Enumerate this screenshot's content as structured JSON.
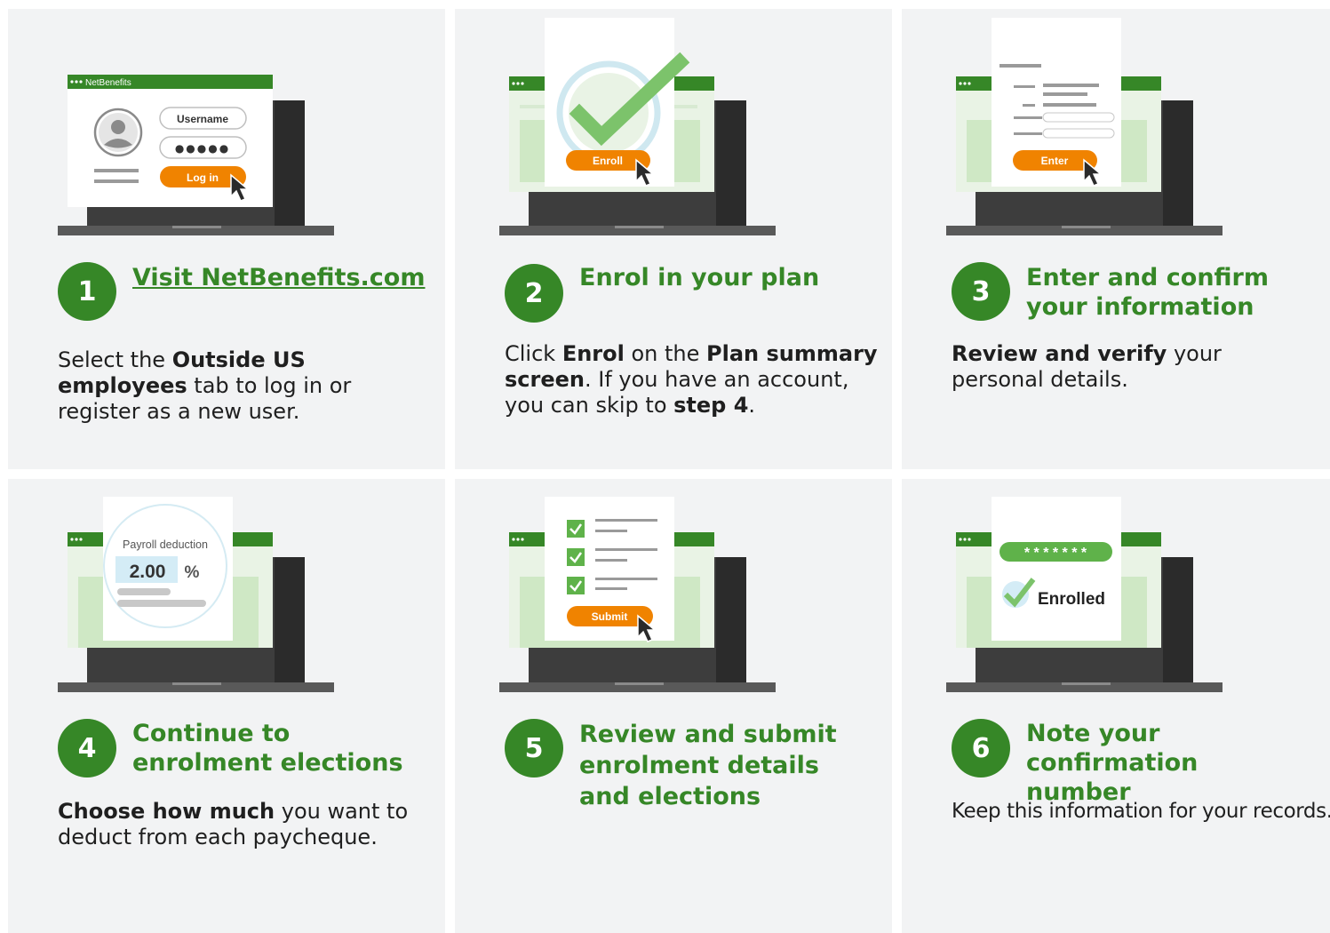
{
  "steps": [
    {
      "number": "1",
      "title": "Visit NetBenefits.com",
      "body": [
        {
          "text": "Select the ",
          "bold": false
        },
        {
          "text": "Outside US employees",
          "bold": true
        },
        {
          "text": " tab to log in or register as a new user.",
          "bold": false
        }
      ],
      "screen": {
        "brand": "NetBenefits",
        "username_label": "Username",
        "password_mask": "●●●●●",
        "button_label": "Log in"
      }
    },
    {
      "number": "2",
      "title": "Enrol in your plan",
      "body": [
        {
          "text": "Click ",
          "bold": false
        },
        {
          "text": "Enrol",
          "bold": true
        },
        {
          "text": " on the ",
          "bold": false
        },
        {
          "text": "Plan summary screen",
          "bold": true
        },
        {
          "text": ". If you have an account, you can skip to ",
          "bold": false
        },
        {
          "text": "step 4",
          "bold": true
        },
        {
          "text": ".",
          "bold": false
        }
      ],
      "screen": {
        "button_label": "Enroll"
      }
    },
    {
      "number": "3",
      "title": "Enter and confirm your information",
      "body": [
        {
          "text": "Review and verify",
          "bold": true
        },
        {
          "text": " your personal details.",
          "bold": false
        }
      ],
      "screen": {
        "button_label": "Enter"
      }
    },
    {
      "number": "4",
      "title": "Continue to enrolment elections",
      "body": [
        {
          "text": "Choose how much",
          "bold": true
        },
        {
          "text": " you want to deduct from each paycheque.",
          "bold": false
        }
      ],
      "screen": {
        "label": "Payroll deduction",
        "value": "2.00",
        "unit": "%"
      }
    },
    {
      "number": "5",
      "title": "Review and submit enrolment details and elections",
      "body": [],
      "screen": {
        "button_label": "Submit"
      }
    },
    {
      "number": "6",
      "title": "Note your confirmation number",
      "body": [
        {
          "text": "Keep this information for your records.",
          "bold": false
        }
      ],
      "screen": {
        "mask": "* * * * * * *",
        "status": "Enrolled"
      }
    }
  ],
  "colors": {
    "green": "#368727",
    "light_green": "#cfe8c5",
    "orange": "#f08300",
    "laptop_dark": "#3d3d3d",
    "card_bg": "#f2f3f4"
  }
}
